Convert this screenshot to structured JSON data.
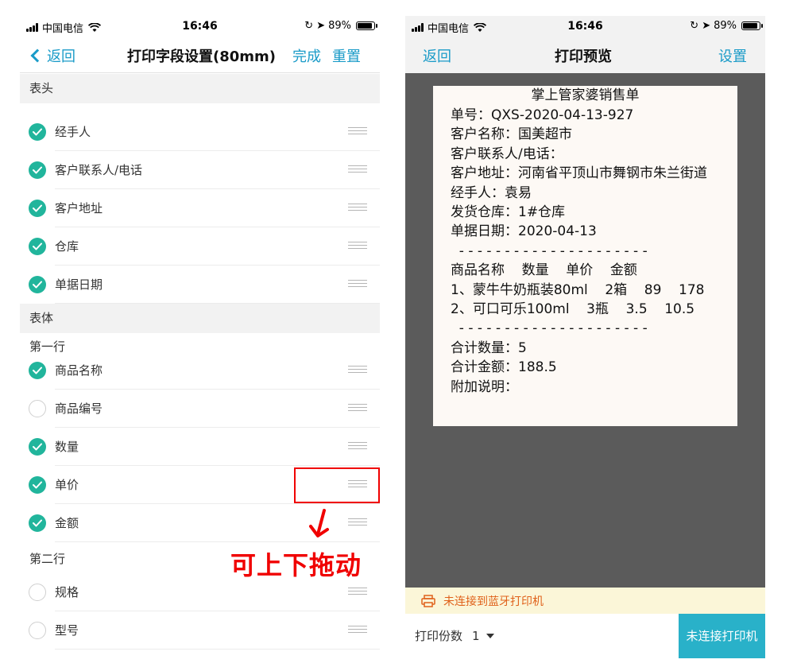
{
  "status_bar": {
    "carrier": "中国电信",
    "time": "16:46",
    "battery": "89%",
    "battery_level": 0.89
  },
  "left_screen": {
    "nav": {
      "back_label": "返回",
      "title": "打印字段设置(80mm)",
      "done_label": "完成",
      "reset_label": "重置"
    },
    "header_section": {
      "title": "表头",
      "fields": [
        {
          "label": "经手人",
          "checked": true
        },
        {
          "label": "客户联系人/电话",
          "checked": true
        },
        {
          "label": "客户地址",
          "checked": true
        },
        {
          "label": "仓库",
          "checked": true
        },
        {
          "label": "单据日期",
          "checked": true
        }
      ]
    },
    "body_section": {
      "title": "表体",
      "row1_label": "第一行",
      "row1_fields": [
        {
          "label": "商品名称",
          "checked": true
        },
        {
          "label": "商品编号",
          "checked": false
        },
        {
          "label": "数量",
          "checked": true
        },
        {
          "label": "单价",
          "checked": true
        },
        {
          "label": "金额",
          "checked": true
        }
      ],
      "row2_label": "第二行",
      "row2_fields": [
        {
          "label": "规格",
          "checked": false
        },
        {
          "label": "型号",
          "checked": false
        }
      ]
    },
    "annotation": "可上下拖动"
  },
  "right_screen": {
    "nav": {
      "back_label": "返回",
      "title": "打印预览",
      "settings_label": "设置"
    },
    "receipt": {
      "title": "掌上管家婆销售单",
      "lines": [
        "单号：QXS-2020-04-13-927",
        "客户名称：国美超市",
        "客户联系人/电话：",
        "客户地址：河南省平顶山市舞钢市朱兰街道",
        "经手人：袁易",
        "发货仓库：1#仓库",
        "单据日期：2020-04-13",
        "  - - - - - - - - - - - - - - - - - - - - -",
        "商品名称    数量    单价    金额",
        "1、蒙牛牛奶瓶装80ml    2箱    89    178",
        "2、可口可乐100ml    3瓶    3.5    10.5",
        "  - - - - - - - - - - - - - - - - - - - - -",
        "合计数量：5",
        "合计金额：188.5",
        "附加说明："
      ]
    },
    "printer_status": "未连接到蓝牙打印机",
    "copies_label": "打印份数",
    "copies_value": "1",
    "connect_button": "未连接打印机"
  },
  "colors": {
    "accent": "#1a9bc8",
    "check": "#21b59c",
    "annotation": "#f00000",
    "connect_button": "#29b1c9",
    "printer_warning": "#e0611a"
  }
}
